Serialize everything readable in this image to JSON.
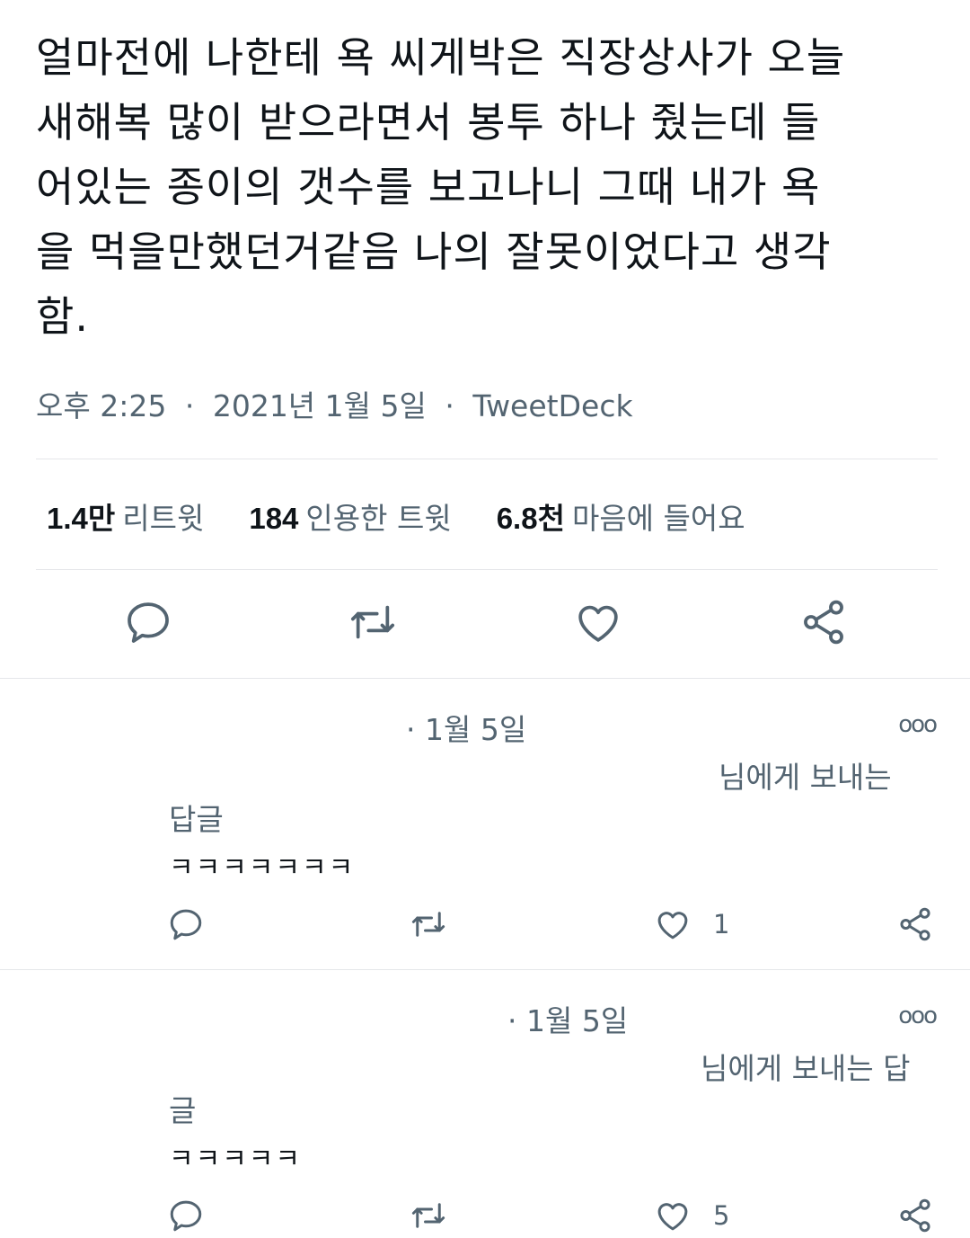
{
  "tweet": {
    "text": "얼마전에 나한테 욕 씨게박은 직장상사가 오늘\n새해복 많이 받으라면서 봉투 하나 줬는데 들\n어있는 종이의 갯수를 보고나니 그때 내가 욕\n을 먹을만했던거같음 나의 잘못이었다고 생각\n함.",
    "time": "오후 2:25",
    "date": "2021년 1월 5일",
    "source": "TweetDeck",
    "separator": "·"
  },
  "stats": [
    {
      "num": "1.4만",
      "label": "리트윗"
    },
    {
      "num": "184",
      "label": "인용한 트윗"
    },
    {
      "num": "6.8천",
      "label": "마음에 들어요"
    }
  ],
  "actions": {
    "reply_icon": "reply-icon",
    "retweet_icon": "retweet-icon",
    "like_icon": "heart-icon",
    "share_icon": "share-icon"
  },
  "replies": [
    {
      "date": "· 1월 5일",
      "more": "ooo",
      "to_line1": "님에게 보내는",
      "to_line2": "답글",
      "text": "ㅋㅋㅋㅋㅋㅋㅋ",
      "like_count": "1"
    },
    {
      "date": "· 1월 5일",
      "more": "ooo",
      "to_line1": "님에게 보내는 답",
      "to_line2": "글",
      "text": "ㅋㅋㅋㅋㅋ",
      "like_count": "5"
    }
  ],
  "colors": {
    "text": "#0f1419",
    "secondary": "#536471",
    "divider": "#e5e7ea"
  }
}
